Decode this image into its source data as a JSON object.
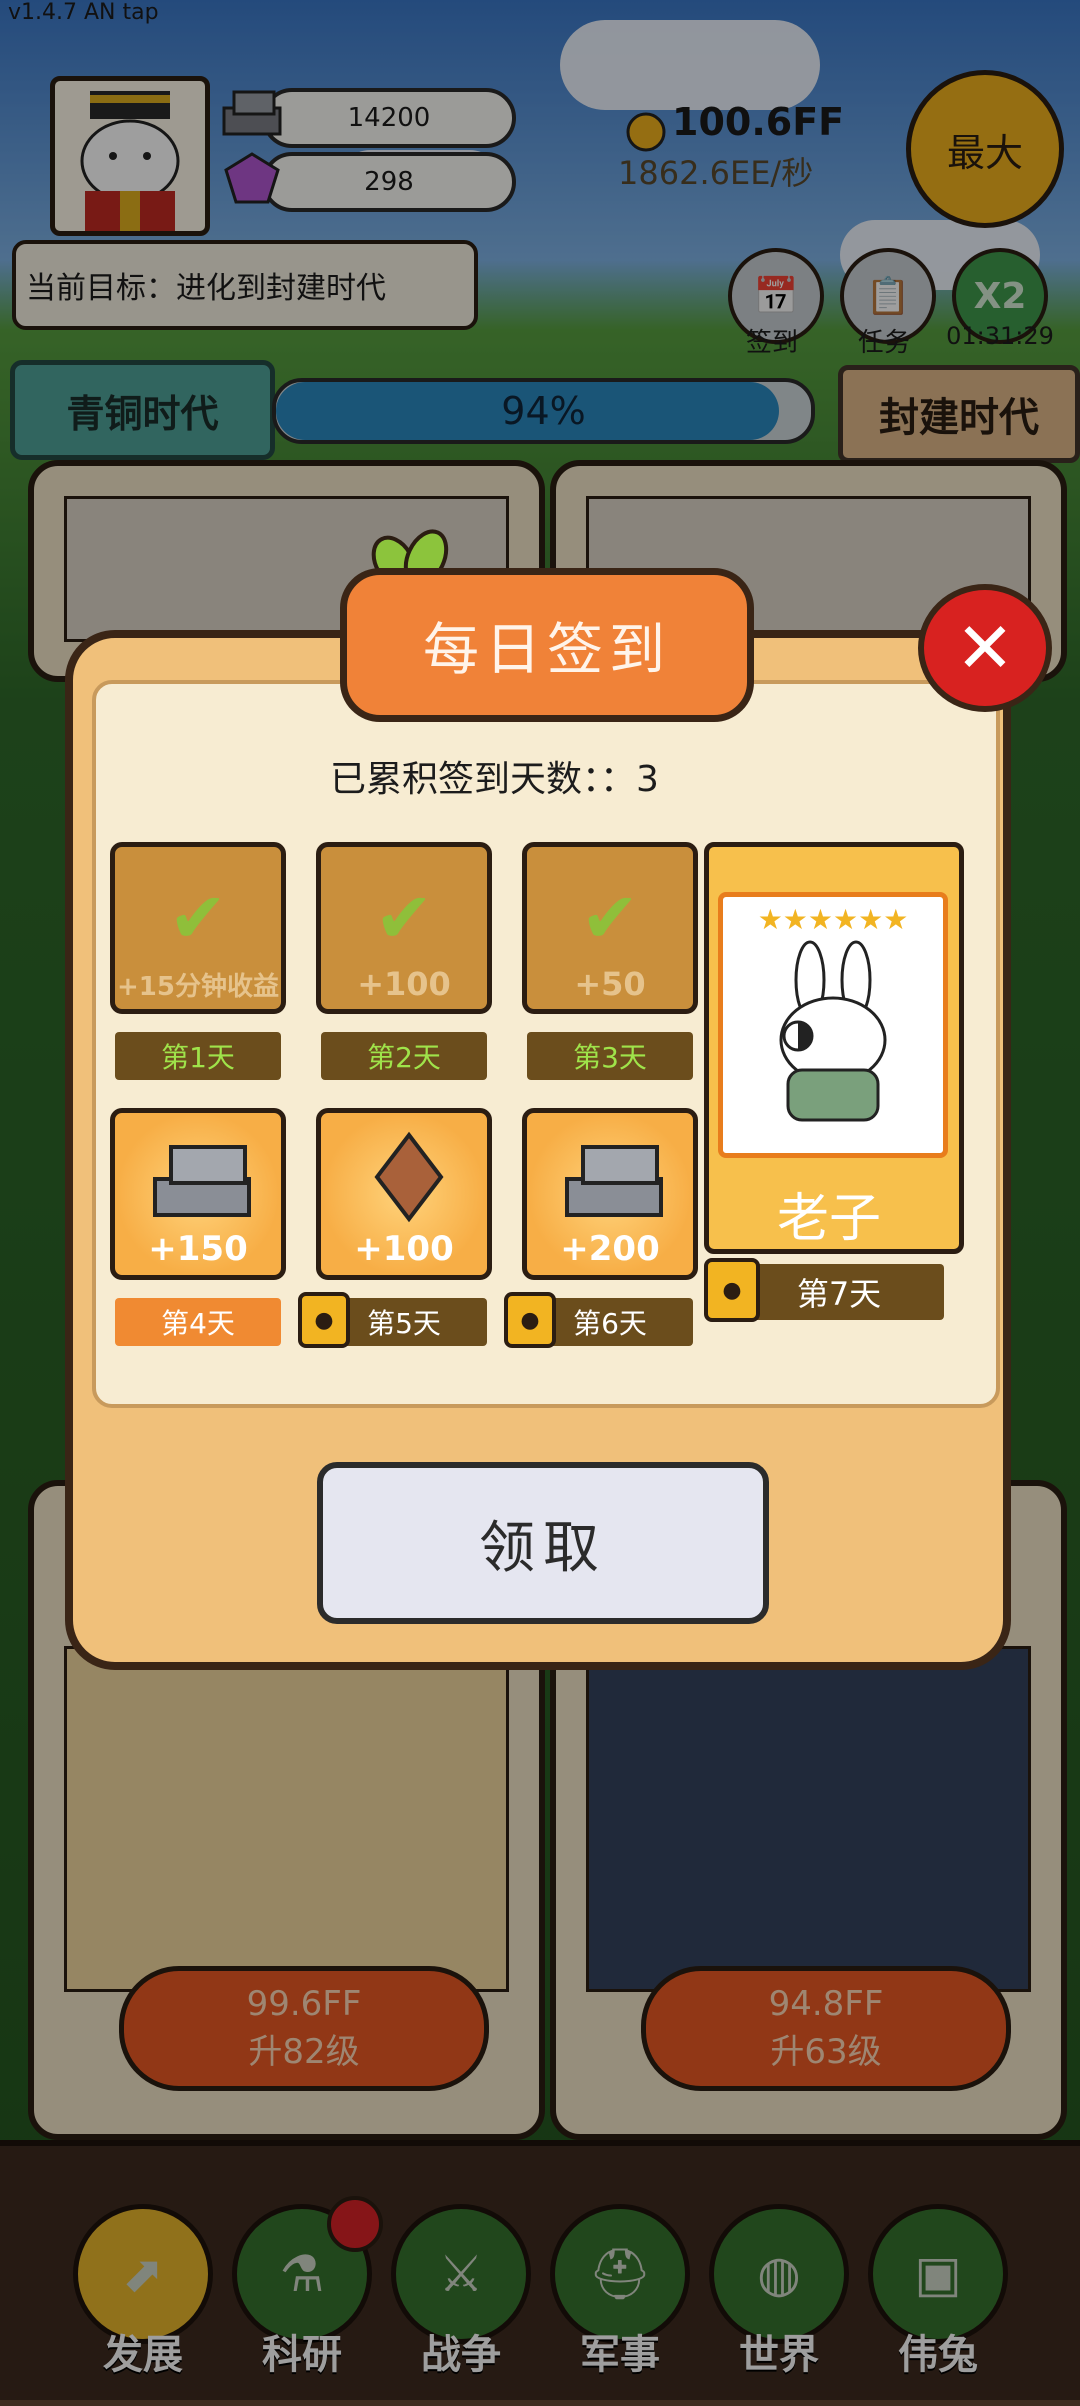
{
  "version": "v1.4.7 AN tap",
  "resources": {
    "iron": "14200",
    "gem": "298",
    "coins": "100.6FF",
    "rate": "1862.6EE/秒"
  },
  "max_button": "最大",
  "goal": "当前目标：进化到封建时代",
  "actions": [
    {
      "label": "签到",
      "icon": "calendar-icon"
    },
    {
      "label": "任务",
      "icon": "task-icon"
    },
    {
      "label": "01:31:29",
      "icon": "x2-boost-icon",
      "text": "X2"
    }
  ],
  "era": {
    "current": "青铜时代",
    "next": "封建时代",
    "progress_text": "94%",
    "progress": 0.94
  },
  "background_cards": [
    {
      "cost": "99.6FF",
      "level": "升82级"
    },
    {
      "cost": "94.8FF",
      "level": "升63级"
    }
  ],
  "dialog": {
    "title": "每日签到",
    "streak": "已累积签到天数：：3",
    "days": [
      {
        "label": "第1天",
        "reward": "+15分钟收益",
        "icon": "coin-icon",
        "state": "claimed"
      },
      {
        "label": "第2天",
        "reward": "+100",
        "icon": "iron-icon",
        "state": "claimed"
      },
      {
        "label": "第3天",
        "reward": "+50",
        "icon": "gem-icon",
        "state": "claimed"
      },
      {
        "label": "第4天",
        "reward": "+150",
        "icon": "iron-icon",
        "state": "active"
      },
      {
        "label": "第5天",
        "reward": "+100",
        "icon": "gem-icon",
        "state": "locked"
      },
      {
        "label": "第6天",
        "reward": "+200",
        "icon": "iron-icon",
        "state": "locked"
      }
    ],
    "day7": {
      "label": "第7天",
      "name": "老子",
      "stars": "★★★★★★",
      "state": "locked"
    },
    "claim_button": "领取"
  },
  "nav": [
    {
      "label": "发展",
      "icon": "develop-icon",
      "active": true
    },
    {
      "label": "科研",
      "icon": "research-icon",
      "active": false
    },
    {
      "label": "战争",
      "icon": "war-icon",
      "active": false
    },
    {
      "label": "军事",
      "icon": "military-icon",
      "active": false
    },
    {
      "label": "世界",
      "icon": "world-icon",
      "active": false
    },
    {
      "label": "伟兔",
      "icon": "hero-icon",
      "active": false
    }
  ]
}
